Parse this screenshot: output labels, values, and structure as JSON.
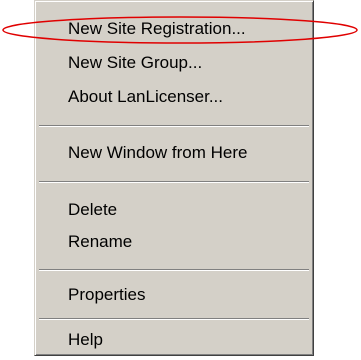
{
  "context_menu": {
    "items": [
      {
        "id": "new-site-registration",
        "label": "New Site Registration..."
      },
      {
        "id": "new-site-group",
        "label": "New Site Group..."
      },
      {
        "id": "about-lanlicenser",
        "label": "About LanLicenser..."
      },
      {
        "id": "new-window-from-here",
        "label": "New Window from Here"
      },
      {
        "id": "delete",
        "label": "Delete"
      },
      {
        "id": "rename",
        "label": "Rename"
      },
      {
        "id": "properties",
        "label": "Properties"
      },
      {
        "id": "help",
        "label": "Help"
      }
    ]
  },
  "annotation": {
    "shape": "ellipse",
    "color": "#e00000",
    "highlights": "New Site Registration..."
  }
}
